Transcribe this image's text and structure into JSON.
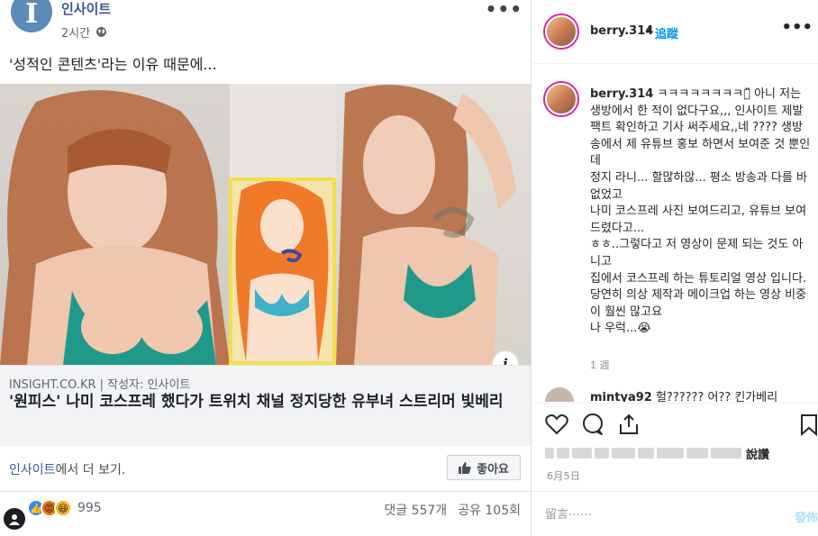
{
  "facebook": {
    "page_name": "인사이트",
    "time": "2시간",
    "caption": "'성적인 콘텐츠'라는 이유 때문에...",
    "link": {
      "domain": "INSIGHT.CO.KR | 작성자: 인사이트",
      "title": "'원피스' 나미 코스프레 했다가 트위치 채널 정지당한 유부녀 스트리머 빛베리"
    },
    "footer": {
      "page": "인사이트",
      "more_suffix": "에서 더 보기.",
      "like_label": "좋아요"
    },
    "stats": {
      "reaction_count": "995",
      "comments": "댓글 557개",
      "shares": "공유 105회"
    },
    "more_icon": "more-dots-icon",
    "info_icon": "info-icon"
  },
  "instagram": {
    "username": "berry.314",
    "dot": "•",
    "follow_label": "追蹤",
    "caption_user": "berry.314",
    "caption_text": "ㅋㅋㅋㅋㅋㅋㅋㅋㅋ̈̈̈̈̈̈̈̈̈ 아니 저는 생방에서 한 적이 없다구요,,, 인사이트 제발 팩트 확인하고 기사 써주세요,,네 ???? 생방송에서 제 유튜브 홍보 하면서 보여준 것 뿐인데\n정지 라니... 할많하않... 평소 방송과 다를 바 없었고\n나미 코스프레 사진 보여드리고, 유튜브 보여드렸다고...\nㅎㅎ..그렇다고 저 영상이 문제 되는 것도 아니고\n집에서 코스프레 하는 튜토리얼 영상 입니다.\n당연히 의상 제작과 메이크업 하는 영상 비중이 훨씬 많고요\n나 우럭...😭",
    "time": "1 週",
    "next_user": "mintya92",
    "next_text": "헐?????? 어?? 킨가베리",
    "likes_suffix": "說讚",
    "date": "6月5日",
    "comment_placeholder": "留言⋯⋯",
    "post_label": "發佈"
  }
}
